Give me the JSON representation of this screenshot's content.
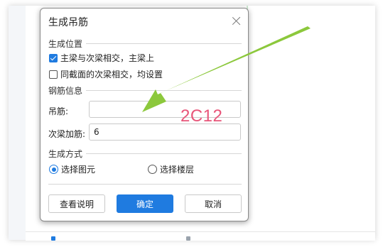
{
  "dialog": {
    "title": "生成吊筋",
    "close_icon": "close-icon"
  },
  "position_section": {
    "title": "生成位置",
    "options": [
      {
        "label": "主梁与次梁相交，主梁上",
        "checked": true
      },
      {
        "label": "同截面的次梁相交，均设置",
        "checked": false
      }
    ]
  },
  "rebar_section": {
    "title": "钢筋信息",
    "hanger_label": "吊筋:",
    "hanger_value": "",
    "secondary_label": "次梁加筋:",
    "secondary_value": "6"
  },
  "mode_section": {
    "title": "生成方式",
    "options": [
      {
        "label": "选择图元",
        "selected": true
      },
      {
        "label": "选择楼层",
        "selected": false
      }
    ]
  },
  "buttons": {
    "help": "查看说明",
    "ok": "确定",
    "cancel": "取消"
  },
  "annotation": {
    "text": "2C12",
    "text_color": "#e8567a",
    "arrow_color": "#8cc83c"
  },
  "colors": {
    "accent": "#1f7be0"
  }
}
